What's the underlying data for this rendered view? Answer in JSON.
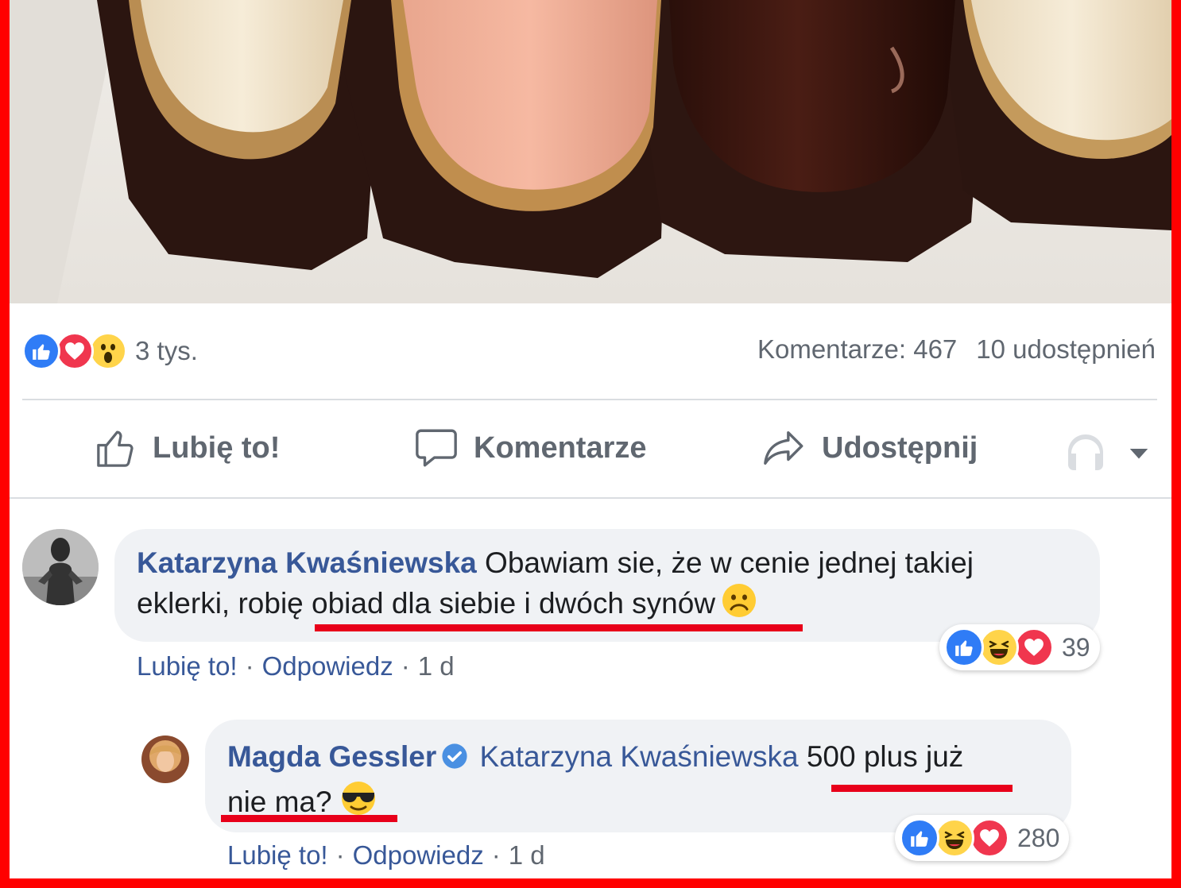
{
  "post": {
    "photo_alt": "eclairs",
    "reactions": {
      "icons": [
        "like-icon",
        "love-icon",
        "wow-icon"
      ],
      "count": "3 tys."
    },
    "comments_count": "Komentarze: 467",
    "shares_count": "10 udostępnień"
  },
  "actions": {
    "like": "Lubię to!",
    "comment": "Komentarze",
    "share": "Udostępnij"
  },
  "comments": [
    {
      "author": "Katarzyna Kwaśniewska",
      "text_line1": "Obawiam sie, że w cenie jednej takiej",
      "text_line2": "eklerki, robię obiad dla siebie i dwóch synów",
      "emoji": "frown-emoji",
      "like_label": "Lubię to!",
      "reply_label": "Odpowiedz",
      "time": "1 d",
      "reactions": {
        "icons": [
          "like-icon",
          "haha-icon",
          "love-icon"
        ],
        "count": "39"
      }
    },
    {
      "author": "Magda Gessler",
      "verified": true,
      "mention": "Katarzyna Kwaśniewska",
      "text_line1": "500 plus już",
      "text_line2": "nie ma?",
      "emoji": "sunglasses-emoji",
      "like_label": "Lubię to!",
      "reply_label": "Odpowiedz",
      "time": "1 d",
      "reactions": {
        "icons": [
          "like-icon",
          "haha-icon",
          "love-icon"
        ],
        "count": "280"
      }
    }
  ],
  "colors": {
    "highlight_frame": "#ff0000",
    "underline": "#e8001a",
    "link": "#385898",
    "like": "#2f7cf6",
    "love": "#f0364e",
    "haha": "#ffd44a"
  }
}
